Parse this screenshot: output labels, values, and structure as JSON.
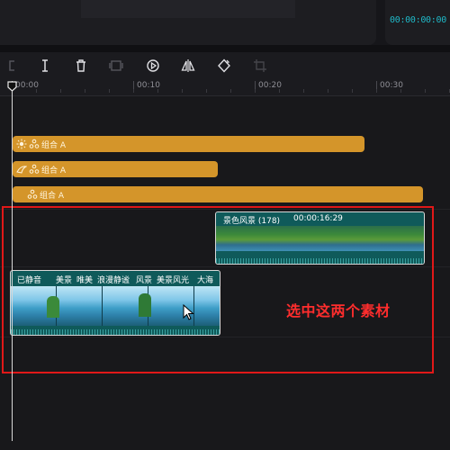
{
  "preview": {
    "timecode": "00:00:00:00"
  },
  "toolbar": {
    "tools": [
      {
        "name": "undo-icon",
        "glyph": "⊏"
      },
      {
        "name": "split-icon",
        "glyph": "I"
      },
      {
        "name": "delete-icon",
        "glyph": "trash"
      },
      {
        "name": "freeze-icon",
        "glyph": "frame"
      },
      {
        "name": "reverse-play-icon",
        "glyph": "play-circle"
      },
      {
        "name": "mirror-icon",
        "glyph": "mirror"
      },
      {
        "name": "rotate-icon",
        "glyph": "rotate"
      },
      {
        "name": "crop-icon",
        "glyph": "crop"
      }
    ]
  },
  "ruler": {
    "ticks": [
      "00:00",
      "00:10",
      "00:20",
      "00:30"
    ]
  },
  "effect_tracks": [
    {
      "label": "组合 A",
      "icon": "sun-icon"
    },
    {
      "label": "组合 A",
      "icon": "sparkle-icon"
    },
    {
      "label": "组合 A",
      "icon": "group-icon"
    }
  ],
  "clips": {
    "upper": {
      "title": "景色风景 (178)",
      "duration": "00:00:16:29"
    },
    "lower": {
      "labels": [
        "已静音",
        "美景",
        "唯美",
        "浪漫静谧",
        "风景",
        "美景风光",
        "大海"
      ]
    }
  },
  "annotation": "选中这两个素材",
  "colors": {
    "accent": "#1fb8c7",
    "effect": "#d4952a",
    "selection": "#e01818",
    "clip": "#0f5a5a"
  }
}
